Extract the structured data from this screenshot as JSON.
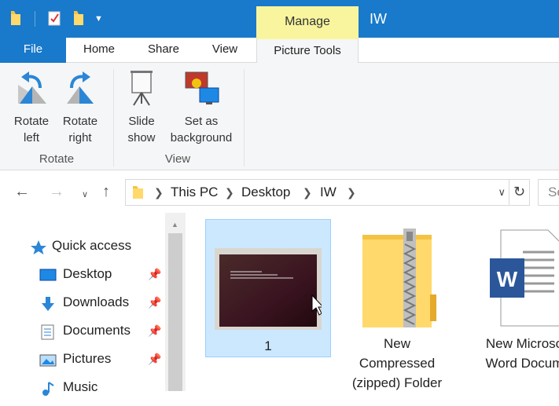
{
  "titlebar": {
    "manage_label": "Manage",
    "window_title": "IW"
  },
  "tabs": {
    "file": "File",
    "home": "Home",
    "share": "Share",
    "view": "View",
    "picture_tools": "Picture Tools"
  },
  "ribbon": {
    "rotate_left": "Rotate\nleft",
    "rotate_right": "Rotate\nright",
    "rotate_group": "Rotate",
    "slide_show": "Slide\nshow",
    "set_background": "Set as\nbackground",
    "view_group": "View"
  },
  "address": {
    "crumbs": [
      "This PC",
      "Desktop",
      "IW"
    ],
    "search_placeholder": "Se"
  },
  "navpane": {
    "items": [
      {
        "label": "Quick access",
        "icon": "star-icon",
        "pinned": false
      },
      {
        "label": "Desktop",
        "icon": "desktop-icon",
        "pinned": true
      },
      {
        "label": "Downloads",
        "icon": "download-icon",
        "pinned": true
      },
      {
        "label": "Documents",
        "icon": "documents-icon",
        "pinned": true
      },
      {
        "label": "Pictures",
        "icon": "pictures-icon",
        "pinned": true
      },
      {
        "label": "Music",
        "icon": "music-icon",
        "pinned": false
      }
    ]
  },
  "files": [
    {
      "label": "1",
      "type": "image",
      "selected": true
    },
    {
      "label": "New\nCompressed\n(zipped) Folder",
      "type": "zip",
      "selected": false
    },
    {
      "label": "New Microso\nWord Docum",
      "type": "word",
      "selected": false
    }
  ],
  "colors": {
    "titlebar": "#1979ca",
    "manage_tab": "#f8f59e",
    "selection": "#cce8ff"
  }
}
